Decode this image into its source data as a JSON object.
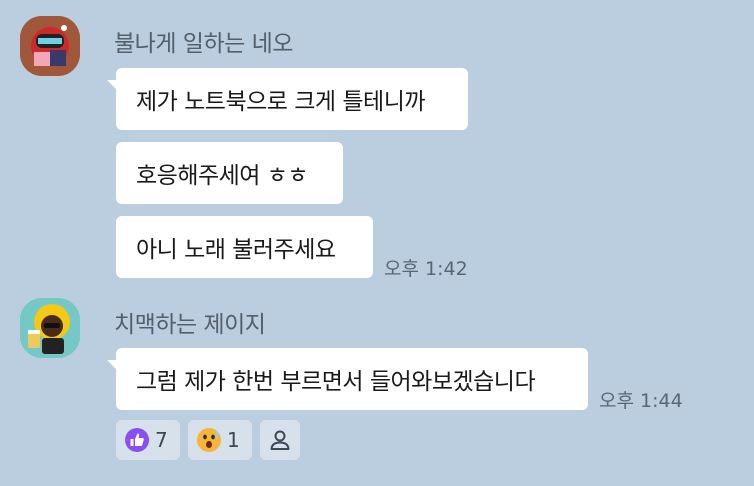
{
  "messages_top": {
    "sender": "불나게 일하는 네오",
    "bubbles": [
      "제가 노트북으로 크게 틀테니까",
      "호응해주세여 ㅎㅎ",
      "아니 노래 불러주세요"
    ],
    "time": "오후 1:42"
  },
  "messages_bottom": {
    "sender": "치맥하는 제이지",
    "bubbles": [
      "그럼 제가 한번 부르면서 들어와보겠습니다"
    ],
    "time": "오후 1:44"
  },
  "reactions": [
    {
      "icon": "thumbs-up-icon",
      "count": "7",
      "color": "#8a4ff0"
    },
    {
      "icon": "surprised-face-icon",
      "count": "1",
      "color": "#f6b53a"
    },
    {
      "icon": "person-icon"
    }
  ],
  "colors": {
    "background": "#bacee0",
    "bubble": "#ffffff",
    "reaction_bg": "#d6e1ec"
  }
}
